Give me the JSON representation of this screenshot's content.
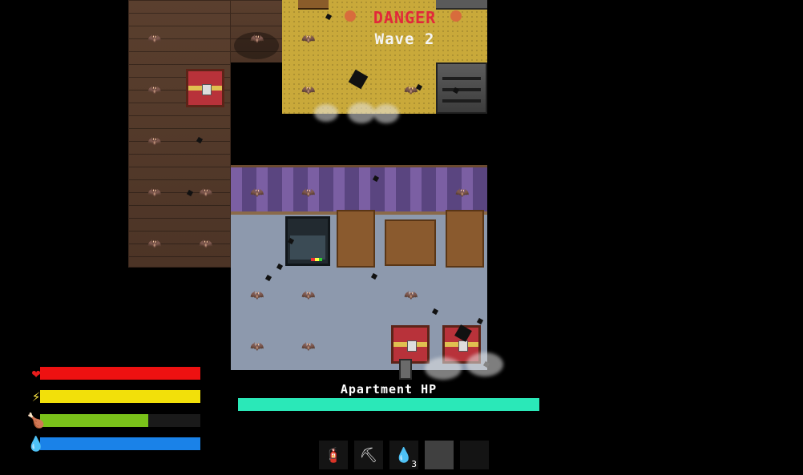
{
  "hud": {
    "danger_text": "DANGER",
    "wave_text": "Wave 2",
    "apartment_label": "Apartment HP",
    "apartment_hp": 1.0,
    "apartment_color": "#2ae8b8"
  },
  "stats": [
    {
      "name": "health",
      "icon": "heart-icon",
      "glyph": "❤",
      "value": 1.0,
      "color": "#ee1111",
      "icon_color": "#e81c1c"
    },
    {
      "name": "energy",
      "icon": "lightning-icon",
      "glyph": "⚡",
      "value": 1.0,
      "color": "#f2e00a",
      "icon_color": "#f5e042"
    },
    {
      "name": "hunger",
      "icon": "meat-icon",
      "glyph": "🍗",
      "value": 0.675,
      "color": "#7ac21a",
      "icon_color": "#d06a5a"
    },
    {
      "name": "thirst",
      "icon": "water-drop-icon",
      "glyph": "💧",
      "value": 1.0,
      "color": "#1a82e8",
      "icon_color": "#2a9ae8"
    }
  ],
  "hotbar": [
    {
      "icon": "fire-extinguisher-icon",
      "glyph": "🧯",
      "count": ""
    },
    {
      "icon": "pickaxe-icon",
      "glyph": "⛏",
      "count": ""
    },
    {
      "icon": "water-drop-icon",
      "glyph": "💧",
      "count": "3"
    },
    {
      "icon": "empty-slot",
      "glyph": "",
      "count": ""
    },
    {
      "icon": "empty-slot",
      "glyph": "",
      "count": ""
    }
  ]
}
